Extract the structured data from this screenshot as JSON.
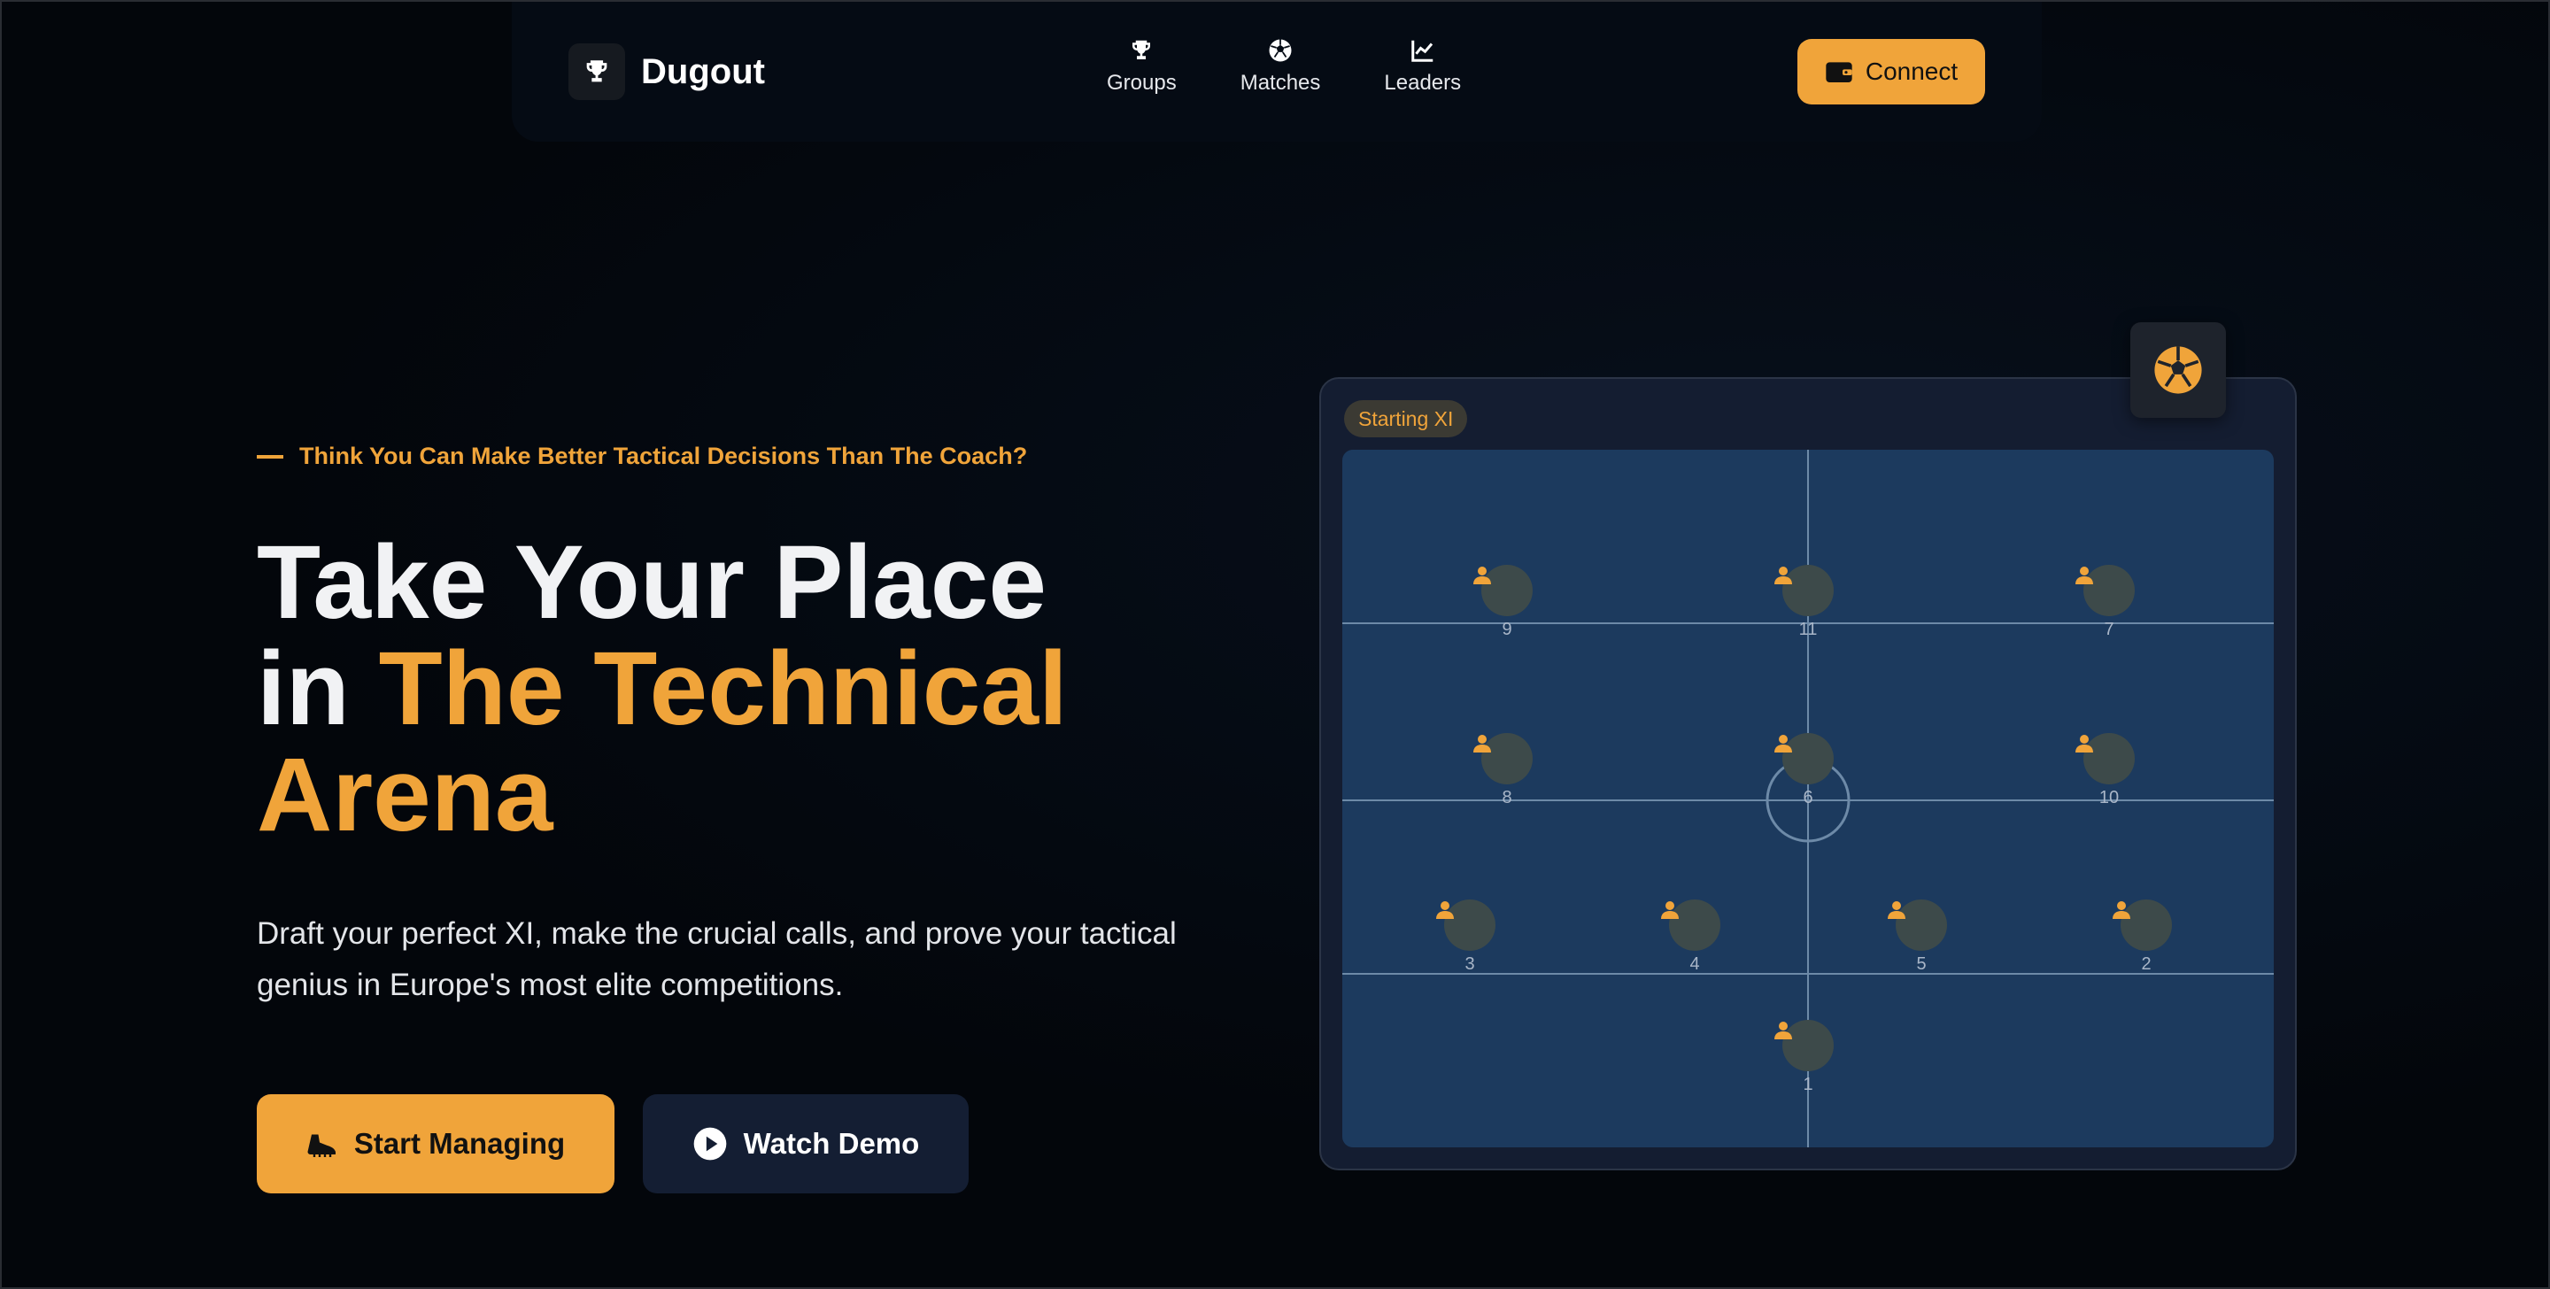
{
  "brand": {
    "name": "Dugout",
    "icon": "trophy-icon"
  },
  "nav": {
    "links": [
      {
        "label": "Groups",
        "icon": "trophy-icon"
      },
      {
        "label": "Matches",
        "icon": "soccer-ball-icon"
      },
      {
        "label": "Leaders",
        "icon": "chart-line-icon"
      }
    ],
    "connect_label": "Connect"
  },
  "hero": {
    "tagline": "Think You Can Make Better Tactical Decisions Than The Coach?",
    "headline_line1": "Take Your Place",
    "headline_in": "in",
    "headline_accent": "The Technical Arena",
    "description": "Draft your perfect XI, make the crucial calls, and prove your tactical genius in Europe's most elite competitions.",
    "primary_button": "Start Managing",
    "secondary_button": "Watch Demo"
  },
  "pitch": {
    "badge": "Starting XI",
    "players": [
      {
        "number": "9"
      },
      {
        "number": "11"
      },
      {
        "number": "7"
      },
      {
        "number": "8"
      },
      {
        "number": "6"
      },
      {
        "number": "10"
      },
      {
        "number": "3"
      },
      {
        "number": "4"
      },
      {
        "number": "5"
      },
      {
        "number": "2"
      },
      {
        "number": "1"
      }
    ]
  },
  "colors": {
    "accent": "#f0a43a",
    "background": "#03060b",
    "pitch": "#1c3a5e",
    "card": "#141d31"
  }
}
